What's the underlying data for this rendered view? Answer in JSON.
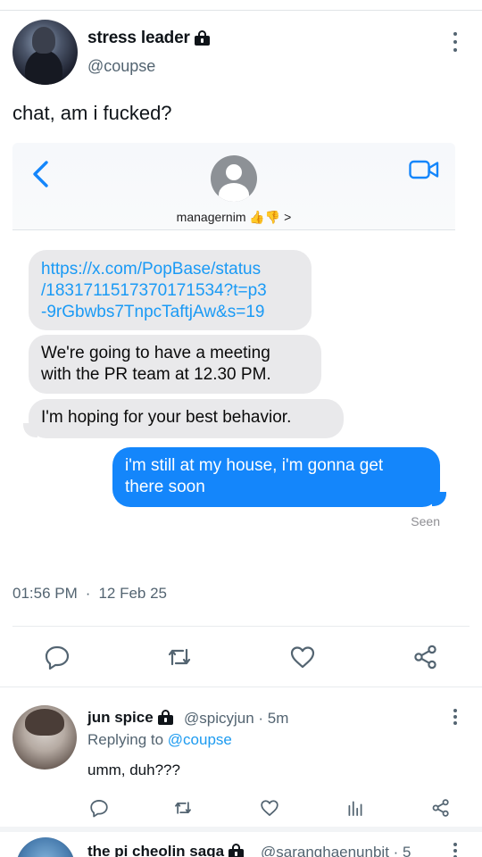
{
  "tweet": {
    "display_name": "stress leader",
    "handle": "@coupse",
    "text": "chat, am i fucked?",
    "time": "01:56 PM",
    "date": "12 Feb 25"
  },
  "screenshot": {
    "contact_name": "managernim 👍👎 >",
    "messages": [
      {
        "from": "them",
        "text": "https://x.com/PopBase/status/1831711517370171534?t=p3-9rGbwbs7TnpcTaftjAw&s=19",
        "lines": [
          "https://x.com/PopBase/status",
          "/1831711517370171534?t=p3",
          "-9rGbwbs7TnpcTaftjAw&s=19"
        ]
      },
      {
        "from": "them",
        "text": "We're going to have a meeting with the PR team at 12.30 PM.",
        "lines": [
          "We're going to have a meeting",
          "with the PR team at 12.30 PM."
        ]
      },
      {
        "from": "them",
        "text": "I'm hoping for your best behavior."
      },
      {
        "from": "me",
        "text": "i'm still at my house, i'm gonna get there soon",
        "lines": [
          "i'm still at my house, i'm gonna get",
          "there soon"
        ]
      }
    ],
    "status": "Seen"
  },
  "reply": {
    "display_name": "jun spice",
    "handle_time": "@spicyjun · 5m",
    "replying_prefix": "Replying to ",
    "replying_to": "@coupse",
    "text": "umm, duh???"
  },
  "next_reply": {
    "display_name": "the pi cheolin saga",
    "handle_time": "@saranghaenunbit · 5"
  },
  "colors": {
    "imessage_blue": "#1486fb",
    "incoming_bubble": "#e9e9eb",
    "link": "#1d9bf0",
    "muted": "#536471"
  }
}
